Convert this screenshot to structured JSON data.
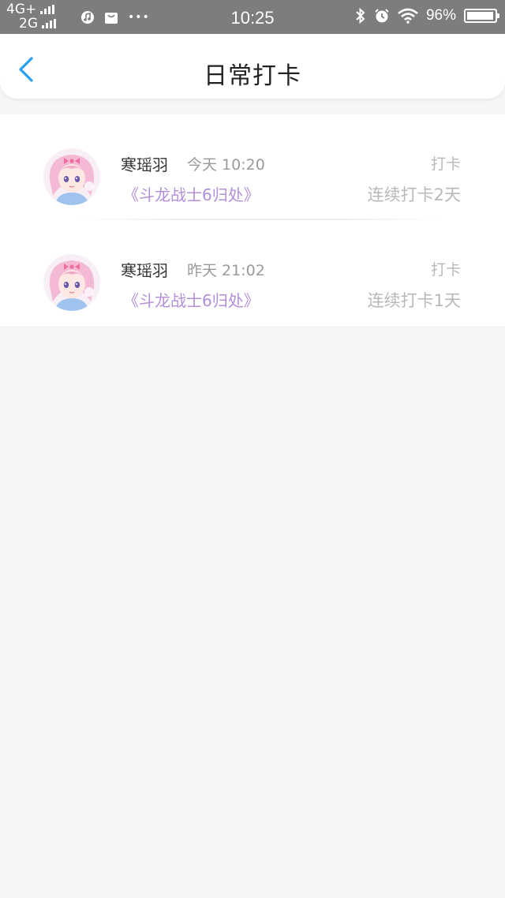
{
  "status_bar": {
    "network_top": "4G+",
    "network_bottom": "2G",
    "more": "•••",
    "time": "10:25",
    "battery_percent": "96%",
    "battery_level": 0.96,
    "icons": [
      "signal-icon",
      "music-app-icon",
      "shopping-bag-icon",
      "bluetooth-icon",
      "alarm-icon",
      "wifi-icon",
      "battery-icon"
    ]
  },
  "header": {
    "title": "日常打卡",
    "back_icon": "chevron-left-icon",
    "accent_color": "#2a9df4"
  },
  "checkins": [
    {
      "user": "寒瑶羽",
      "time": "今天 10:20",
      "book": "《斗龙战士6归处》",
      "action": "打卡",
      "streak": "连续打卡2天"
    },
    {
      "user": "寒瑶羽",
      "time": "昨天 21:02",
      "book": "《斗龙战士6归处》",
      "action": "打卡",
      "streak": "连续打卡1天"
    }
  ],
  "colors": {
    "book_title": "#b38fd8",
    "muted_text": "#b8b8b8",
    "status_bar_bg": "#7d7d7d"
  }
}
